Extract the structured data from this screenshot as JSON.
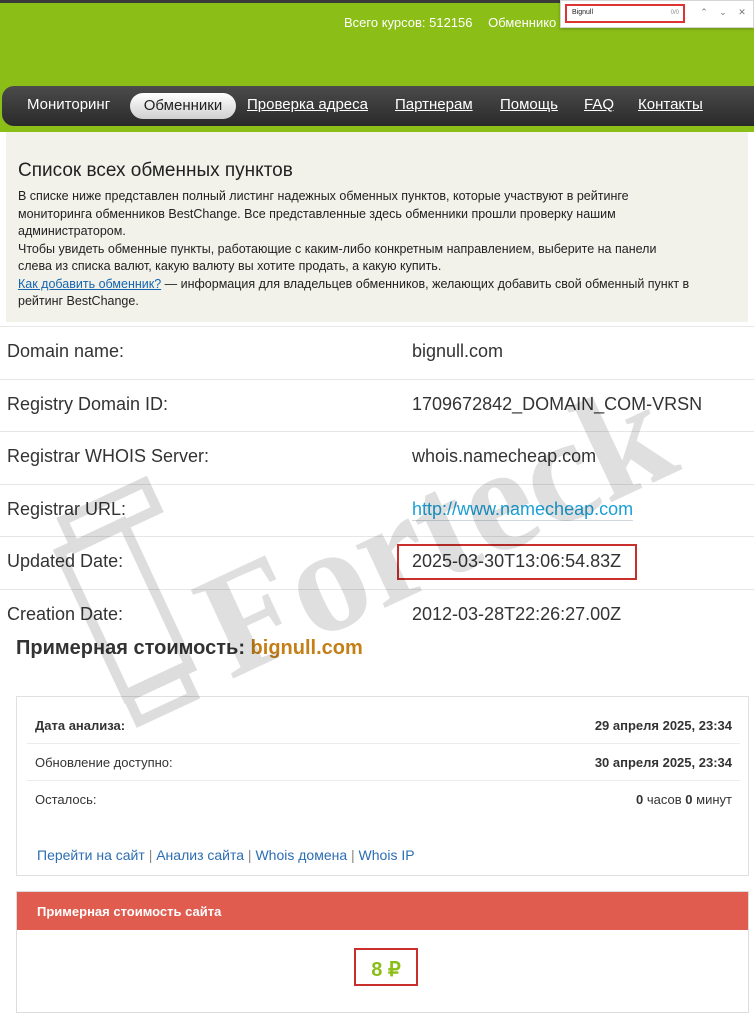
{
  "header": {
    "stats_total_label": "Всего курсов: 512156",
    "stats_exchangers_label": "Обменнико"
  },
  "findbar": {
    "query": "Bignull",
    "count": "0/0",
    "prev_icon": "chevron-up-icon",
    "next_icon": "chevron-down-icon",
    "close_icon": "close-icon"
  },
  "nav": {
    "items": [
      {
        "label": "Мониторинг"
      },
      {
        "label": "Обменники"
      },
      {
        "label": "Проверка адреса"
      },
      {
        "label": "Партнерам"
      },
      {
        "label": "Помощь"
      },
      {
        "label": "FAQ"
      },
      {
        "label": "Контакты"
      }
    ],
    "active": "Обменники"
  },
  "intro": {
    "title": "Список всех обменных пунктов",
    "p1_line1": "В списке ниже представлен полный листинг надежных обменных пунктов, которые участвуют в рейтинге",
    "p1_line2": "мониторинга обменников BestChange. Все представленные здесь обменники прошли проверку нашим",
    "p1_line3": "администратором.",
    "p2_line1": "Чтобы увидеть обменные пункты, работающие с каким-либо конкретным направлением, выберите на панели",
    "p2_line2": "слева из списка валют, какую валюту вы хотите продать, а какую купить.",
    "link": "Как добавить обменник?",
    "p3_rest": " — информация для владельцев обменников, желающих добавить свой обменный пункт в",
    "p3_line2": "рейтинг BestChange."
  },
  "whois": {
    "rows": [
      {
        "key": "Domain name:",
        "value": "bignull.com"
      },
      {
        "key": "Registry Domain ID:",
        "value": "1709672842_DOMAIN_COM-VRSN"
      },
      {
        "key": "Registrar WHOIS Server:",
        "value": "whois.namecheap.com"
      },
      {
        "key": "Registrar URL:",
        "value": "http://www.namecheap.com"
      },
      {
        "key": "Updated Date:",
        "value": "2025-03-30T13:06:54.83Z"
      },
      {
        "key": "Creation Date:",
        "value": "2012-03-28T22:26:27.00Z"
      }
    ]
  },
  "price": {
    "title": "Примерная стоимость:",
    "domain": "bignull.com"
  },
  "analysis": {
    "date_label": "Дата анализа:",
    "date_value": "29 апреля 2025, 23:34",
    "update_label": "Обновление доступно:",
    "update_value": "30 апреля 2025, 23:34",
    "left_label": "Осталось:",
    "left_hours": "0",
    "left_hours_unit": "часов",
    "left_minutes": "0",
    "left_minutes_unit": "минут",
    "links": [
      "Перейти на сайт",
      "Анализ сайта",
      "Whois домена",
      "Whois IP"
    ],
    "separator": "|"
  },
  "cost": {
    "header": "Примерная стоимость сайта",
    "value": "8 ₽"
  },
  "watermark": {
    "text": "Forteck"
  },
  "colors": {
    "brand_green": "#8cbe18",
    "accent_red": "#e05c4f",
    "highlight_red": "#c9302c",
    "link_blue": "#1a9fd6",
    "domain_orange": "#c47f17"
  }
}
